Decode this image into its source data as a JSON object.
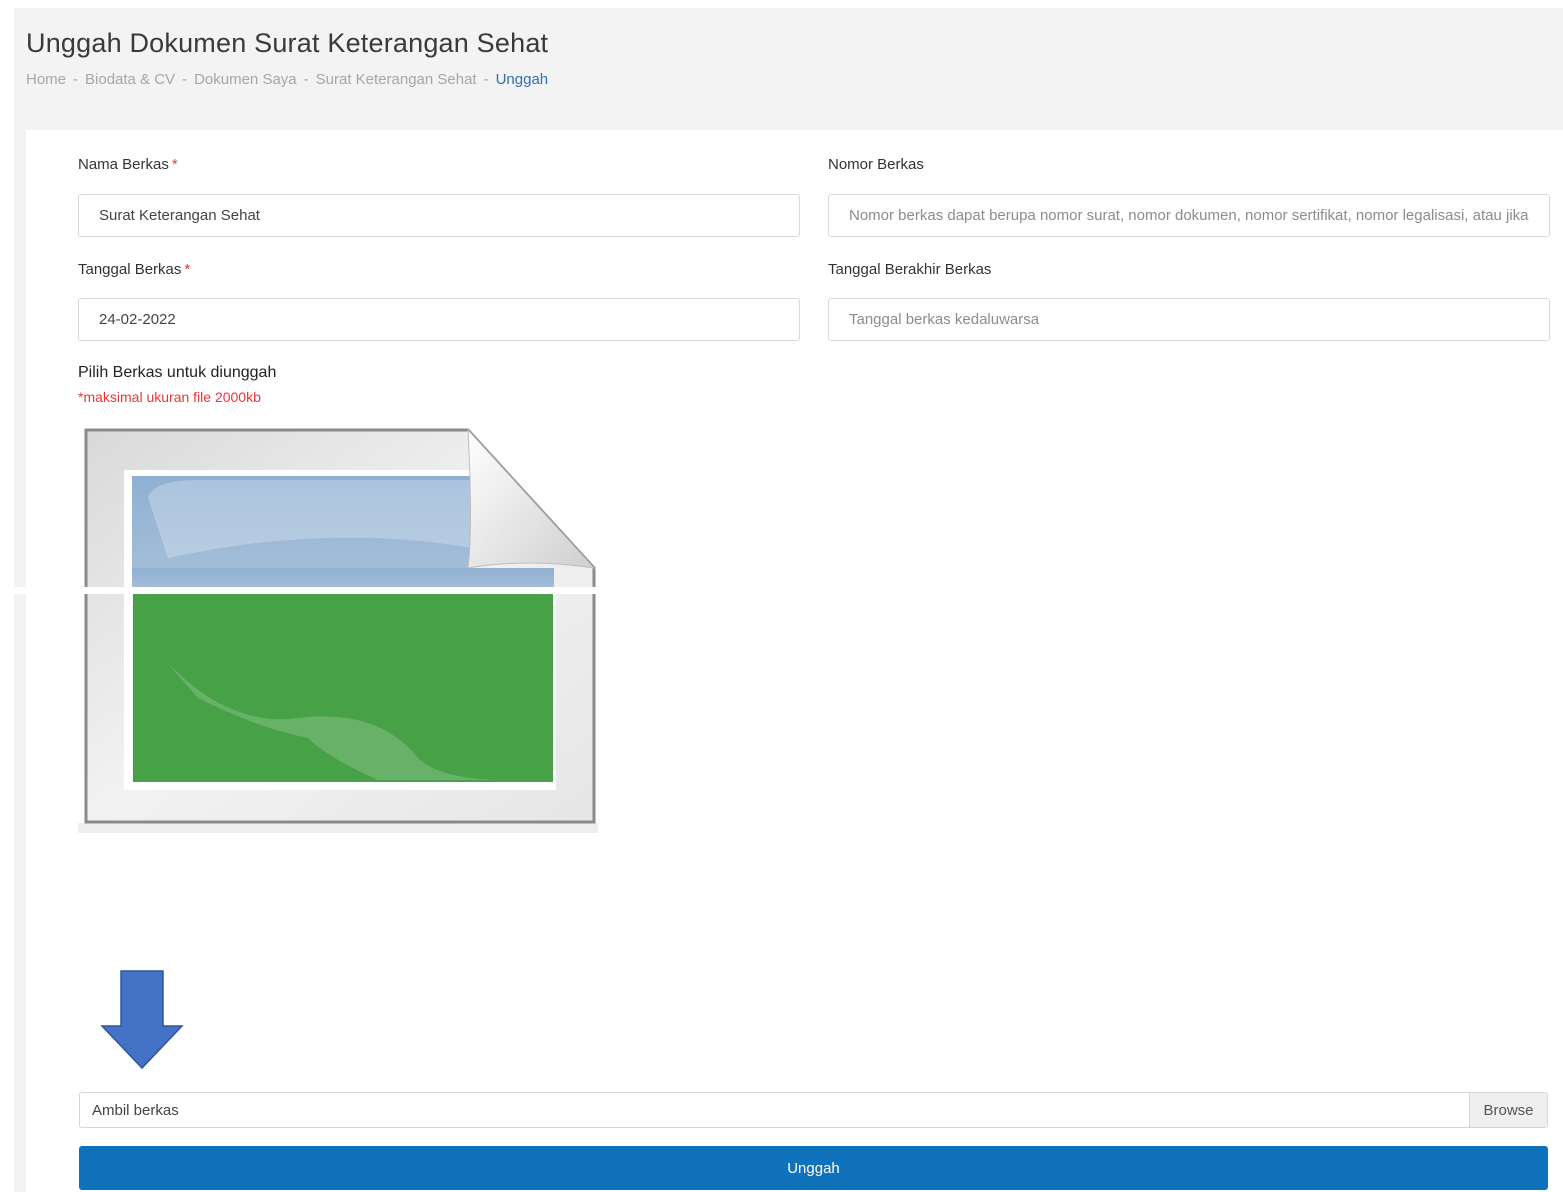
{
  "header": {
    "title": "Unggah Dokumen Surat Keterangan Sehat",
    "breadcrumb": [
      "Home",
      "Biodata & CV",
      "Dokumen Saya",
      "Surat Keterangan Sehat"
    ],
    "breadcrumb_active": "Unggah",
    "separator": "-"
  },
  "form": {
    "nama_berkas": {
      "label": "Nama Berkas",
      "required_mark": "*",
      "value": "Surat Keterangan Sehat"
    },
    "nomor_berkas": {
      "label": "Nomor Berkas",
      "placeholder": "Nomor berkas dapat berupa nomor surat, nomor dokumen, nomor sertifikat, nomor legalisasi, atau jika"
    },
    "tanggal_berkas": {
      "label": "Tanggal Berkas",
      "required_mark": "*",
      "value": "24-02-2022"
    },
    "tanggal_berakhir": {
      "label": "Tanggal Berakhir Berkas",
      "placeholder": "Tanggal berkas kedaluwarsa"
    },
    "upload": {
      "label": "Pilih Berkas untuk diunggah",
      "note": "*maksimal ukuran file 2000kb",
      "preview_icon": "image-placeholder-icon",
      "file_text": "Ambil berkas",
      "browse_label": "Browse"
    },
    "submit_label": "Unggah"
  },
  "colors": {
    "primary": "#1072ba",
    "required": "#e03b3b",
    "link": "#2f6fb2",
    "arrow": "#4472c4",
    "preview_green": "#46a147",
    "preview_blue": "#9ab6d3"
  }
}
